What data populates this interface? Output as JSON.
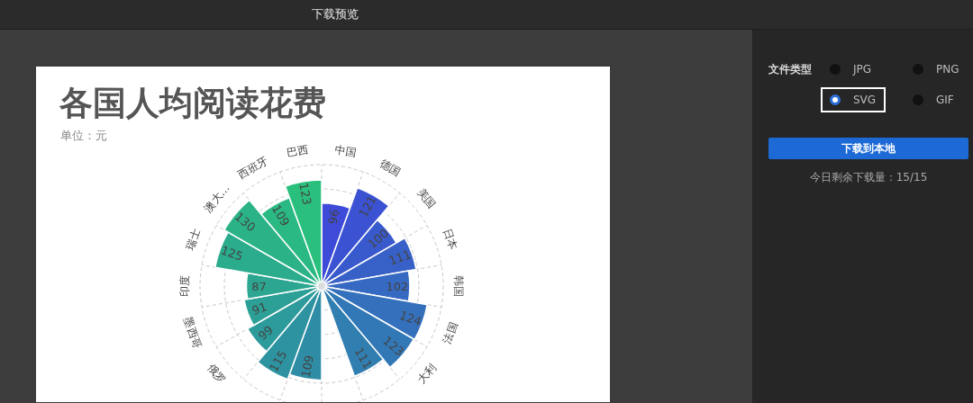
{
  "window": {
    "title": "下载预览"
  },
  "preview": {
    "title": "各国人均阅读花费",
    "subtitle": "单位：元",
    "rose_chart": {
      "left_half": [
        {
          "kind": "bar",
          "category": "巴西",
          "value": "123"
        },
        {
          "kind": "bar",
          "category": "西班牙",
          "value": "109"
        },
        {
          "kind": "bar",
          "category": "澳大…",
          "value": "130"
        },
        {
          "kind": "bar",
          "category": "瑞士",
          "value": "125"
        },
        {
          "kind": "bar",
          "category": "印度",
          "value": "87"
        },
        {
          "kind": "bar",
          "category": "墨西哥",
          "value": "91"
        },
        {
          "kind": "bar",
          "category": "俄罗",
          "value": "99"
        },
        {
          "kind": "bar",
          "value": "115"
        },
        {
          "kind": "bar",
          "value": "109"
        }
      ],
      "right_half": [
        {
          "kind": "bar",
          "category": "中国",
          "value": "96"
        },
        {
          "kind": "bar",
          "category": "德国",
          "value": "121"
        },
        {
          "kind": "bar",
          "category": "美国",
          "value": "100"
        },
        {
          "kind": "bar",
          "category": "日本",
          "value": "111"
        },
        {
          "kind": "bar",
          "category": "韩国",
          "value": "102"
        },
        {
          "kind": "bar",
          "category": "法国",
          "value": "124"
        },
        {
          "kind": "bar",
          "category": "大利",
          "value": "123"
        },
        {
          "kind": "bar",
          "value": "111"
        },
        {
          "kind": "hidden"
        }
      ]
    }
  },
  "export": {
    "label": "文件类型",
    "formats": [
      {
        "label": "JPG",
        "selected": false
      },
      {
        "label": "PNG",
        "selected": false
      },
      {
        "label": "SVG",
        "selected": true
      },
      {
        "label": "GIF",
        "selected": false
      }
    ],
    "button": "下载到本地",
    "quota": "今日剩余下载量：15/15"
  }
}
